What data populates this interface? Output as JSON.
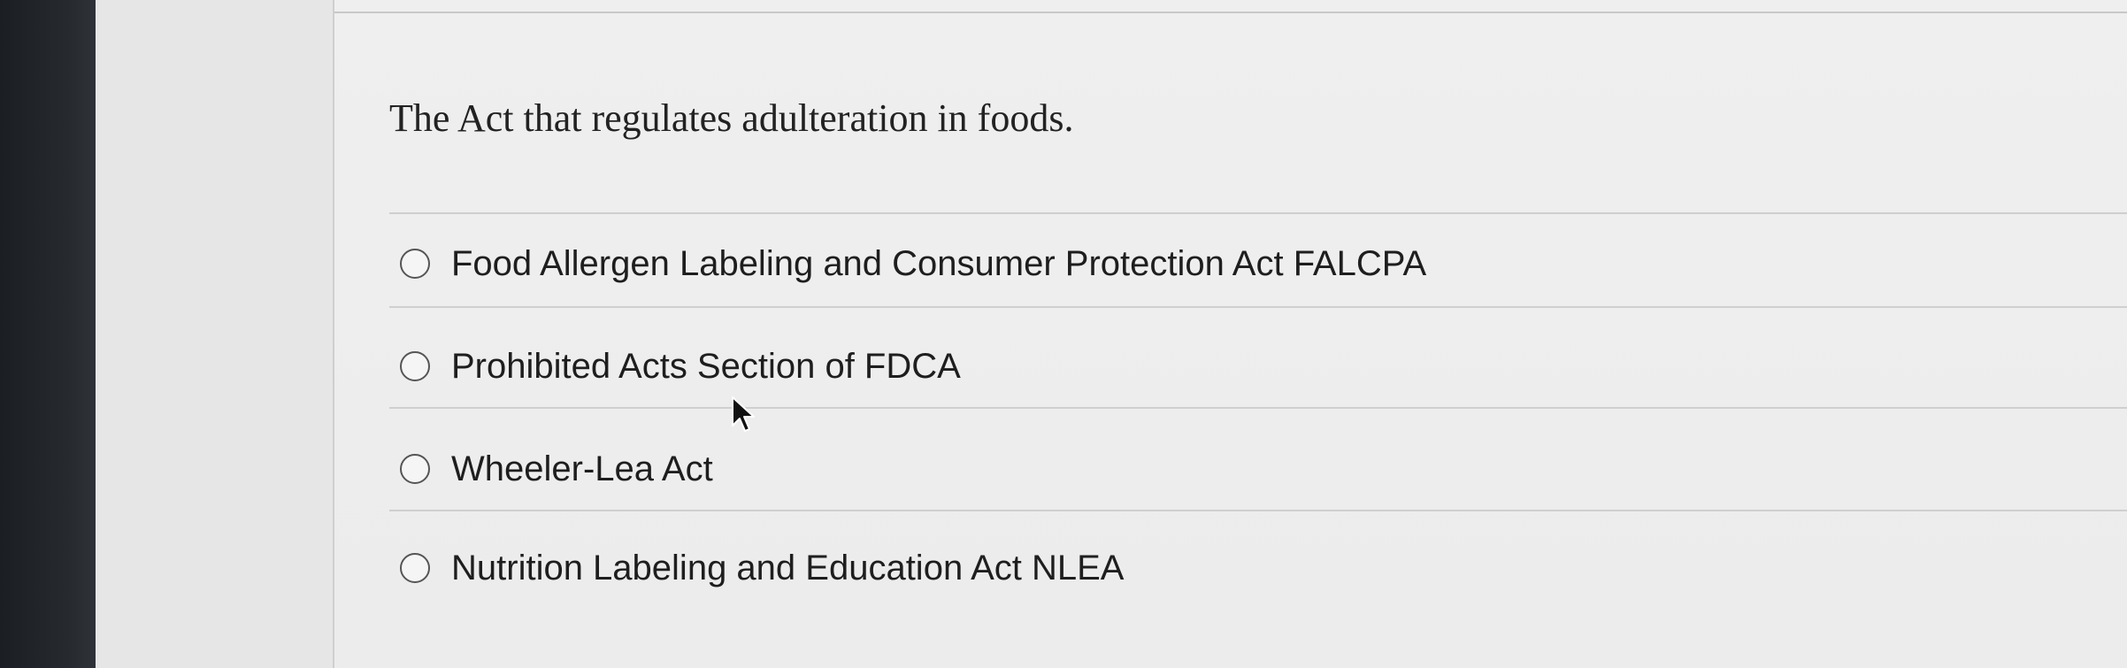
{
  "question": {
    "text": "The Act that regulates adulteration in foods."
  },
  "options": [
    {
      "label": "Food Allergen Labeling and Consumer Protection Act FALCPA",
      "selected": false
    },
    {
      "label": "Prohibited Acts Section of FDCA",
      "selected": false
    },
    {
      "label": "Wheeler-Lea Act",
      "selected": false
    },
    {
      "label": "Nutrition Labeling and Education Act NLEA",
      "selected": false
    }
  ],
  "icons": {
    "radio": "radio-unselected-icon",
    "cursor": "mouse-pointer-icon"
  }
}
